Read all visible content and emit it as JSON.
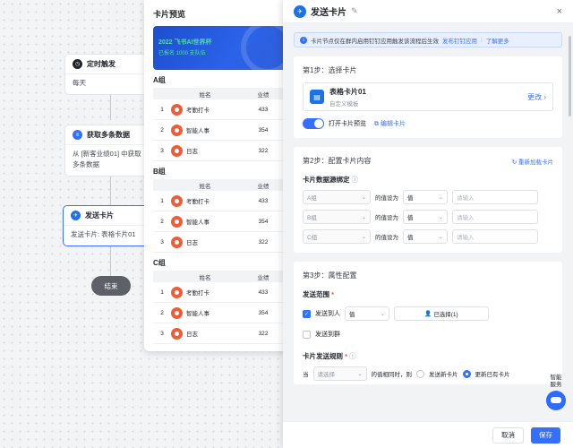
{
  "flow": {
    "nodes": [
      {
        "title": "定时触发",
        "body": "每天"
      },
      {
        "title": "获取多条数据",
        "body": "从 [新客业绩01] 中获取多条数据"
      },
      {
        "title": "发送卡片",
        "body": "发送卡片: 表格卡片01"
      }
    ],
    "end_label": "结束"
  },
  "preview": {
    "title": "卡片预览",
    "banner_line1": "2022 飞书AI世界杯",
    "banner_line2": "已报名 1000 支队伍",
    "col_name": "姓名",
    "col_value": "业绩",
    "groups": [
      {
        "title": "A组",
        "rows": [
          {
            "num": "1",
            "name": "考勤打卡",
            "value": "433"
          },
          {
            "num": "2",
            "name": "智能人事",
            "value": "354"
          },
          {
            "num": "3",
            "name": "日志",
            "value": "322"
          }
        ]
      },
      {
        "title": "B组",
        "rows": [
          {
            "num": "1",
            "name": "考勤打卡",
            "value": "433"
          },
          {
            "num": "2",
            "name": "智能人事",
            "value": "354"
          },
          {
            "num": "3",
            "name": "日志",
            "value": "322"
          }
        ]
      },
      {
        "title": "C组",
        "rows": [
          {
            "num": "1",
            "name": "考勤打卡",
            "value": "433"
          },
          {
            "num": "2",
            "name": "智能人事",
            "value": "354"
          },
          {
            "num": "3",
            "name": "日志",
            "value": "322"
          }
        ]
      }
    ]
  },
  "drawer": {
    "title": "发送卡片",
    "close": "×",
    "notice_text": "卡片节点仅在群内启用钉钉应用触发该流程后生效",
    "notice_link1": "发布钉钉应用",
    "notice_link2": "了解更多",
    "step1": {
      "title": "第1步：选择卡片",
      "card_name": "表格卡片01",
      "card_sub": "自定义模板",
      "change": "更改",
      "toggle_label": "打开卡片预览",
      "edit_card": "编辑卡片"
    },
    "step2": {
      "title": "第2步：配置卡片内容",
      "reload": "重新加载卡片",
      "bind_label": "卡片数据源绑定",
      "rows": [
        {
          "group": "A组",
          "set_label": "的值设为",
          "value": "值",
          "placeholder": "请输入"
        },
        {
          "group": "B组",
          "set_label": "的值设为",
          "value": "值",
          "placeholder": "请输入"
        },
        {
          "group": "C组",
          "set_label": "的值设为",
          "value": "值",
          "placeholder": "请输入"
        }
      ]
    },
    "step3": {
      "title": "第3步：属性配置",
      "range_label": "发送范围",
      "send_to_person": "发送到人",
      "person_value": "值",
      "selected": "已选择(1)",
      "send_to_group": "发送到群",
      "rule_label": "卡片发送规则",
      "when": "当",
      "rule_placeholder": "请选择",
      "rule_text": "的值相同时，则",
      "opt_new": "发送新卡片",
      "opt_update": "更新已有卡片"
    },
    "cancel": "取消",
    "save": "保存"
  },
  "assistant": {
    "line1": "智能",
    "line2": "服务"
  },
  "colors": {
    "accent": "#3370ff",
    "tomato": "#ee5d38",
    "end_node": "#5d6066"
  }
}
